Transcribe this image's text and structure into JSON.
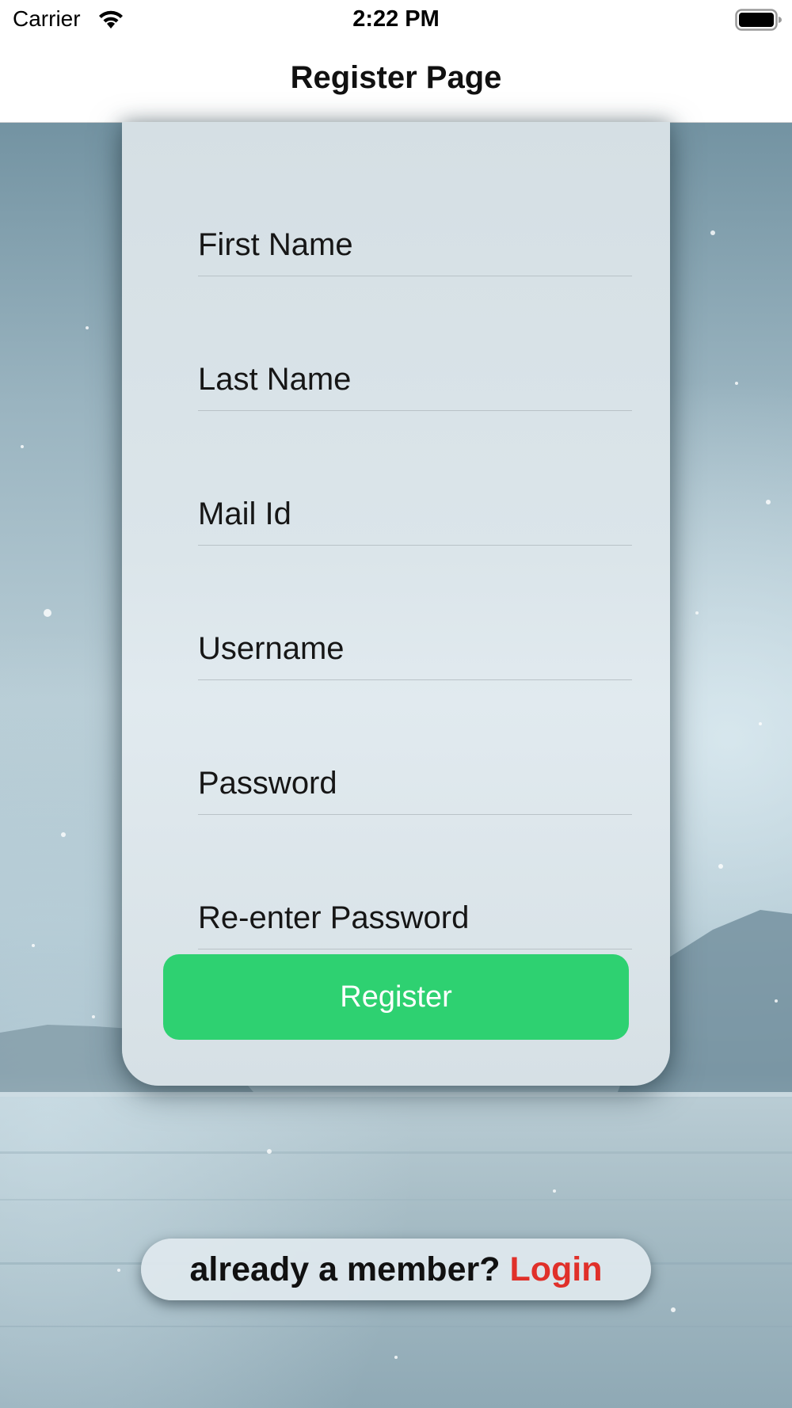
{
  "status_bar": {
    "carrier": "Carrier",
    "time": "2:22 PM",
    "wifi_icon": "wifi-icon",
    "battery_icon": "battery-icon"
  },
  "nav": {
    "title": "Register Page"
  },
  "form": {
    "fields": [
      {
        "placeholder": "First Name",
        "value": ""
      },
      {
        "placeholder": "Last Name",
        "value": ""
      },
      {
        "placeholder": "Mail Id",
        "value": ""
      },
      {
        "placeholder": "Username",
        "value": ""
      },
      {
        "placeholder": "Password",
        "value": ""
      },
      {
        "placeholder": "Re-enter Password",
        "value": ""
      }
    ],
    "register_label": "Register"
  },
  "footer": {
    "prompt": "already a member? ",
    "login_label": "Login"
  },
  "colors": {
    "register_button": "#2ed171",
    "login_link": "#e0302a"
  }
}
